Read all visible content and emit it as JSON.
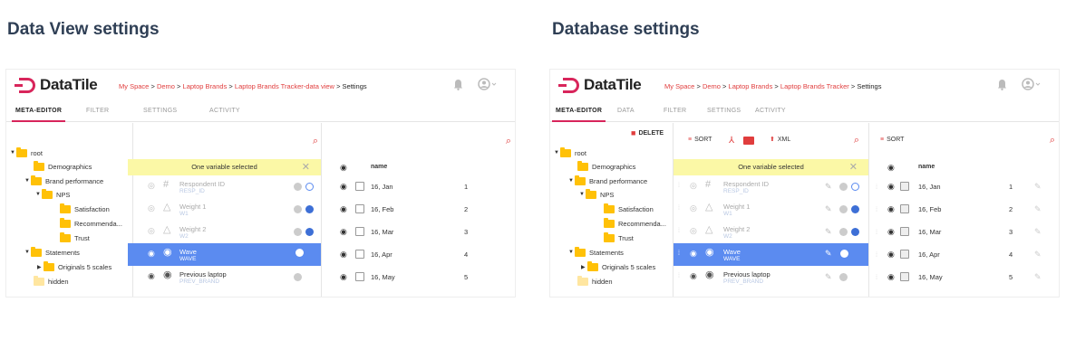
{
  "left": {
    "heading": "Data View settings",
    "logo": "DataTile",
    "crumbs": [
      "My Space",
      "Demo",
      "Laptop Brands",
      "Laptop Brands Tracker-data view"
    ],
    "crumb_current": "Settings",
    "tabs": [
      "META-EDITOR",
      "FILTER",
      "SETTINGS",
      "ACTIVITY"
    ]
  },
  "right": {
    "heading": "Database settings",
    "logo": "DataTile",
    "crumbs": [
      "My Space",
      "Demo",
      "Laptop Brands",
      "Laptop Brands Tracker"
    ],
    "crumb_current": "Settings",
    "tabs": [
      "META-EDITOR",
      "DATA",
      "FILTER",
      "SETTINGS",
      "ACTIVITY"
    ],
    "toolbar": {
      "delete": "DELETE",
      "sort": "SORT",
      "xml": "XML",
      "sort2": "SORT"
    }
  },
  "crumb_sep": ">",
  "tree": {
    "root": "root",
    "demographics": "Demographics",
    "brand": "Brand performance",
    "nps": "NPS",
    "satisfaction": "Satisfaction",
    "recommend": "Recommenda...",
    "trust": "Trust",
    "statements": "Statements",
    "originals": "Originals 5 scales",
    "hidden": "hidden"
  },
  "selection_banner": "One variable selected",
  "variables": [
    {
      "name": "Respondent ID",
      "code": "RESP_ID",
      "type": "#"
    },
    {
      "name": "Weight 1",
      "code": "W1",
      "type": "△"
    },
    {
      "name": "Weight 2",
      "code": "W2",
      "type": "△"
    },
    {
      "name": "Wave",
      "code": "WAVE",
      "type": "◉"
    },
    {
      "name": "Previous laptop",
      "code": "PREV_BRAND",
      "type": "◉"
    }
  ],
  "values_header": "name",
  "values": [
    {
      "name": "16, Jan",
      "num": "1"
    },
    {
      "name": "16, Feb",
      "num": "2"
    },
    {
      "name": "16, Mar",
      "num": "3"
    },
    {
      "name": "16, Apr",
      "num": "4"
    },
    {
      "name": "16, May",
      "num": "5"
    }
  ],
  "colors": {
    "accent": "#d8255b",
    "selection": "#5b8bf0",
    "banner": "#fbf8a6",
    "folder": "#ffc107",
    "link": "#e03d3d"
  },
  "icons": {
    "search": "🔍︎",
    "eye": "👁",
    "bell": "bell-icon",
    "user": "user-icon"
  }
}
